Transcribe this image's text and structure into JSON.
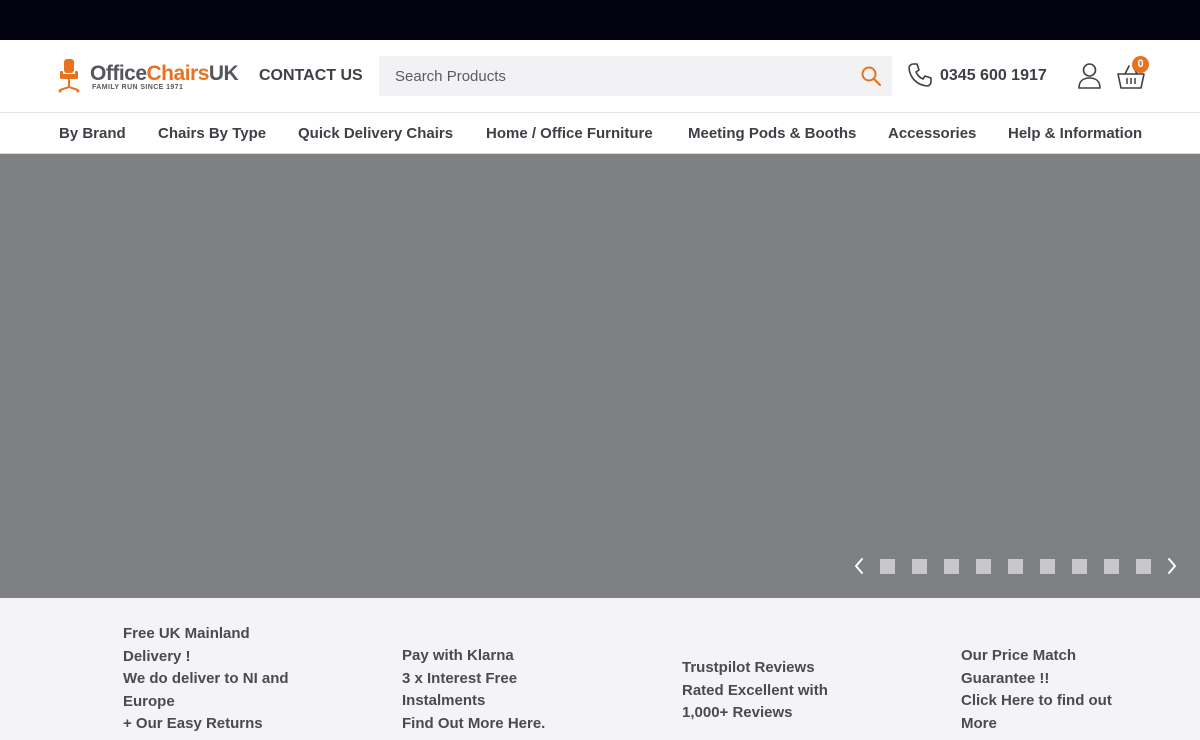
{
  "brand": {
    "name_part1": "Office",
    "name_part2": "Chairs",
    "name_part3": "UK",
    "tagline": "FAMILY RUN SINCE 1971",
    "accent_color": "#e8731f"
  },
  "header": {
    "contact_label": "CONTACT US",
    "search_placeholder": "Search Products",
    "phone": "0345 600 1917",
    "basket_count": "0",
    "icons": [
      "search-icon",
      "phone-icon",
      "account-icon",
      "basket-icon"
    ]
  },
  "nav": {
    "items": [
      "By Brand",
      "Chairs By Type",
      "Quick Delivery Chairs",
      "Home / Office Furniture",
      "Meeting Pods & Booths",
      "Accessories",
      "Help & Information"
    ]
  },
  "carousel": {
    "slide_count": 9,
    "background_color": "#7f8084"
  },
  "features": [
    {
      "lines": [
        "Free UK Mainland",
        "Delivery !",
        "We do deliver to NI and",
        "Europe",
        "+ Our Easy Returns"
      ]
    },
    {
      "lines": [
        "Pay with Klarna",
        "3 x Interest Free",
        "Instalments",
        "Find Out More Here."
      ]
    },
    {
      "lines": [
        "Trustpilot Reviews",
        "Rated Excellent with",
        "1,000+ Reviews"
      ]
    },
    {
      "lines": [
        "Our Price Match",
        "Guarantee !!",
        "Click Here to find out",
        "More"
      ]
    }
  ]
}
